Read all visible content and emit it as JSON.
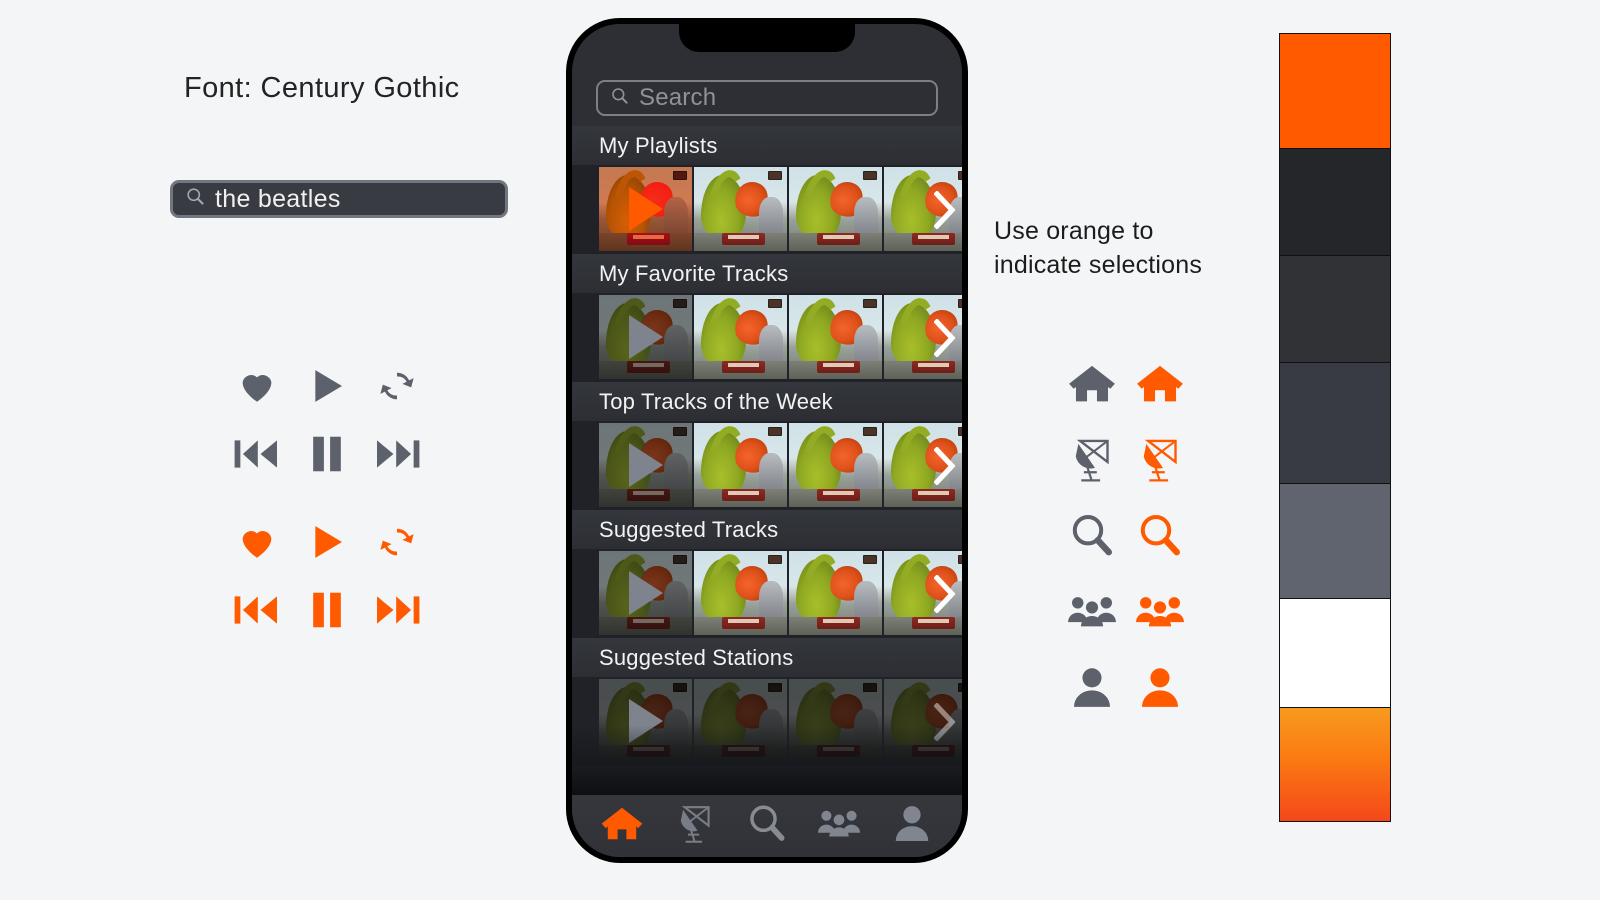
{
  "annotations": {
    "font_note": "Font: Century Gothic",
    "orange_note_line1": "Use orange to",
    "orange_note_line2": "indicate selections"
  },
  "demo_search": {
    "value": "the beatles",
    "icon": "search-icon",
    "border_color": "#72767f",
    "fill_color": "#383b42",
    "text_color": "#f0f0f0"
  },
  "icon_samples": {
    "gray_color": "#5c616b",
    "orange_color": "#ff5a00",
    "gray_set": [
      {
        "name": "heart-icon",
        "label": "Heart"
      },
      {
        "name": "play-icon",
        "label": "Play"
      },
      {
        "name": "repeat-icon",
        "label": "Repeat"
      },
      {
        "name": "previous-icon",
        "label": "Previous"
      },
      {
        "name": "pause-icon",
        "label": "Pause"
      },
      {
        "name": "next-icon",
        "label": "Next"
      }
    ],
    "orange_set": [
      {
        "name": "heart-icon",
        "label": "Heart"
      },
      {
        "name": "play-icon",
        "label": "Play"
      },
      {
        "name": "repeat-icon",
        "label": "Repeat"
      },
      {
        "name": "previous-icon",
        "label": "Previous"
      },
      {
        "name": "pause-icon",
        "label": "Pause"
      },
      {
        "name": "next-icon",
        "label": "Next"
      }
    ]
  },
  "icon_pairs": [
    {
      "name": "home-icon",
      "label": "Home"
    },
    {
      "name": "radio-dish-icon",
      "label": "Radio"
    },
    {
      "name": "search-icon",
      "label": "Search"
    },
    {
      "name": "group-icon",
      "label": "Friends"
    },
    {
      "name": "person-icon",
      "label": "Profile"
    }
  ],
  "swatches": [
    {
      "name": "swatch-orange-solid",
      "color": "#ff5a00"
    },
    {
      "name": "swatch-near-black",
      "color": "#252629"
    },
    {
      "name": "swatch-dark-gray",
      "color": "#303236"
    },
    {
      "name": "swatch-slate",
      "color": "#383b44"
    },
    {
      "name": "swatch-mid-gray",
      "color": "#5f646f"
    },
    {
      "name": "swatch-white",
      "color": "#ffffff"
    },
    {
      "name": "swatch-orange-gradient",
      "color": "#f79b1e"
    }
  ],
  "phone": {
    "search": {
      "placeholder": "Search",
      "icon": "search-icon"
    },
    "sections": [
      {
        "title": "My Playlists",
        "first_tile": "selected",
        "play_overlay": "orange"
      },
      {
        "title": "My Favorite Tracks",
        "first_tile": "dim",
        "play_overlay": "gray"
      },
      {
        "title": "Top Tracks of the Week",
        "first_tile": "dim",
        "play_overlay": "gray"
      },
      {
        "title": "Suggested Tracks",
        "first_tile": "dim",
        "play_overlay": "gray"
      },
      {
        "title": "Suggested Stations",
        "first_tile": "fade",
        "play_overlay": "gray"
      }
    ],
    "tabs": [
      {
        "name": "tab-home",
        "label": "Home",
        "active": true
      },
      {
        "name": "tab-radio",
        "label": "Radio",
        "active": false
      },
      {
        "name": "tab-search",
        "label": "Search",
        "active": false
      },
      {
        "name": "tab-friends",
        "label": "Friends",
        "active": false
      },
      {
        "name": "tab-profile",
        "label": "Profile",
        "active": false
      }
    ]
  }
}
